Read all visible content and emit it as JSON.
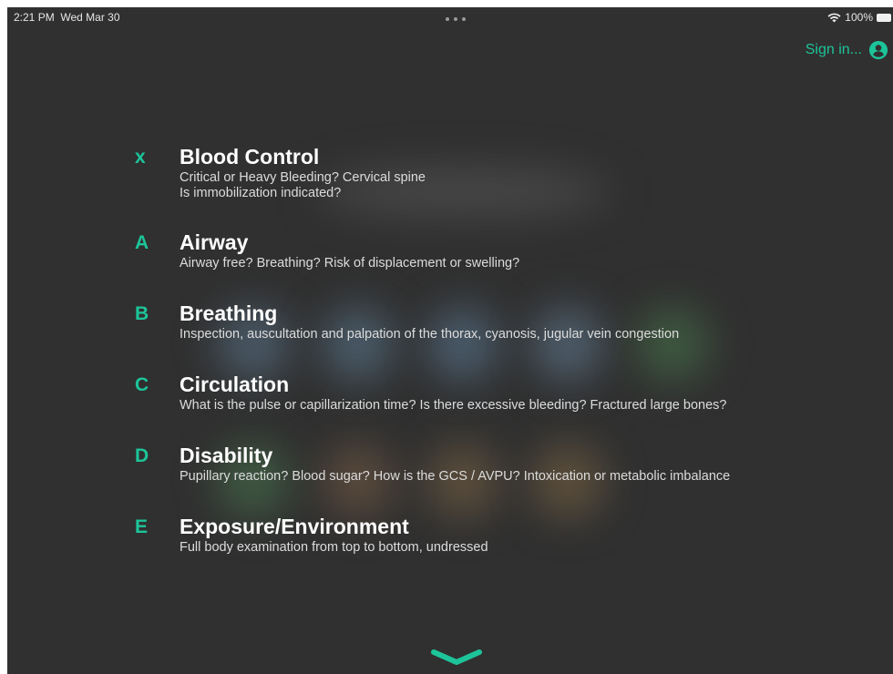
{
  "status_bar": {
    "time": "2:21 PM",
    "date": "Wed Mar 30",
    "battery": "100%",
    "wifi_icon": "wifi-icon",
    "battery_icon": "battery-icon"
  },
  "header": {
    "sign_in_label": "Sign in...",
    "accent_color": "#1dc49a"
  },
  "items": [
    {
      "letter": "x",
      "title": "Blood Control",
      "desc_lines": [
        "Critical or Heavy Bleeding? Cervical spine",
        "Is immobilization indicated?"
      ]
    },
    {
      "letter": "A",
      "title": "Airway",
      "desc_lines": [
        "Airway free? Breathing? Risk of displacement or swelling?"
      ]
    },
    {
      "letter": "B",
      "title": "Breathing",
      "desc_lines": [
        "Inspection, auscultation and palpation of the thorax, cyanosis, jugular vein congestion"
      ]
    },
    {
      "letter": "C",
      "title": "Circulation",
      "desc_lines": [
        "What is the pulse or capillarization time? Is there excessive bleeding? Fractured large bones?"
      ]
    },
    {
      "letter": "D",
      "title": "Disability",
      "desc_lines": [
        "Pupillary reaction? Blood sugar? How is the GCS / AVPU? Intoxication or metabolic imbalance"
      ]
    },
    {
      "letter": "E",
      "title": "Exposure/Environment",
      "desc_lines": [
        "Full body examination from top to bottom, undressed"
      ]
    }
  ]
}
